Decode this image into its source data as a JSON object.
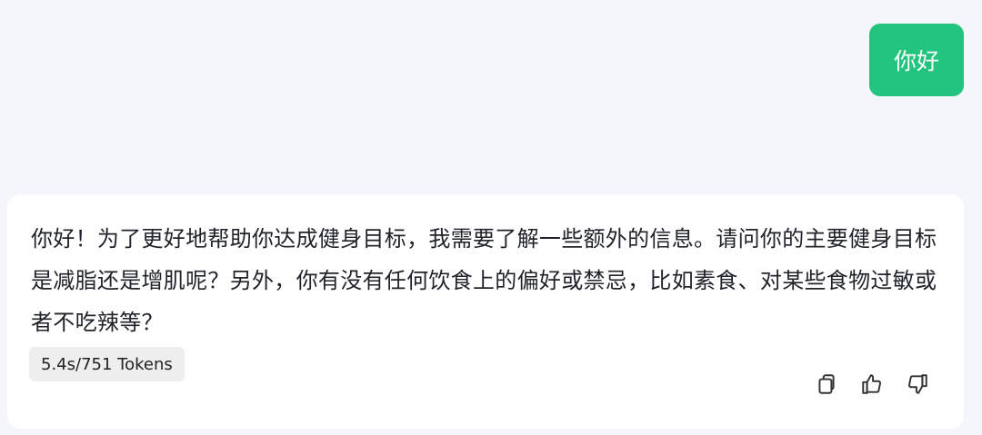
{
  "user_message": {
    "text": "你好"
  },
  "assistant_message": {
    "text": "你好！为了更好地帮助你达成健身目标，我需要了解一些额外的信息。请问你的主要健身目标是减脂还是增肌呢？另外，你有没有任何饮食上的偏好或禁忌，比如素食、对某些食物过敏或者不吃辣等？",
    "meta": "5.4s/751 Tokens",
    "actions": [
      {
        "name": "copy",
        "icon": "copy-icon"
      },
      {
        "name": "like",
        "icon": "thumbs-up-icon"
      },
      {
        "name": "dislike",
        "icon": "thumbs-down-icon"
      }
    ]
  },
  "colors": {
    "background": "#f3f6fa",
    "user_bubble": "#22c47e",
    "assistant_card": "#ffffff",
    "token_chip": "#eeeeee",
    "text": "#1f2329",
    "icon": "#333333"
  }
}
